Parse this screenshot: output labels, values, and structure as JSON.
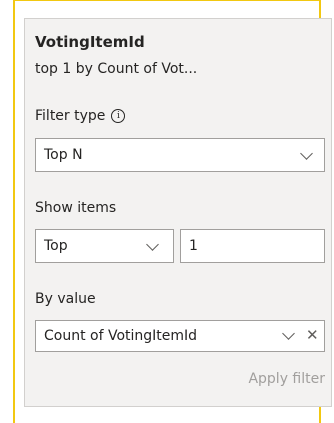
{
  "filter_card": {
    "field_name": "VotingItemId",
    "summary": "top 1 by Count of Vot...",
    "filter_type_label": "Filter type",
    "filter_type_info_icon": "info-icon",
    "filter_type_value": "Top N",
    "show_items_label": "Show items",
    "show_items_direction": "Top",
    "show_items_count": "1",
    "by_value_label": "By value",
    "by_value_field": "Count of VotingItemId",
    "apply_label": "Apply filter"
  },
  "colors": {
    "selection_border": "#f2c811",
    "card_background": "#f3f2f1",
    "disabled_text": "#a19f9d"
  }
}
